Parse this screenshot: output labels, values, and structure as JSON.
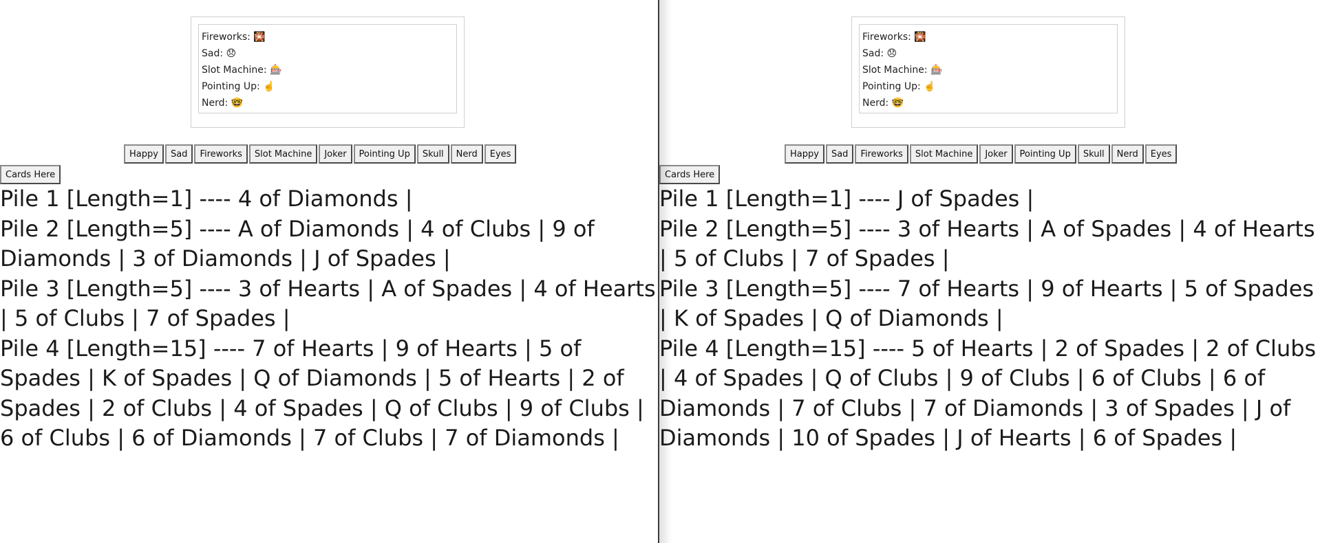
{
  "emoji_list_label": "emoji-list",
  "emoji_buttons": [
    "Happy",
    "Sad",
    "Fireworks",
    "Slot Machine",
    "Joker",
    "Pointing Up",
    "Skull",
    "Nerd",
    "Eyes"
  ],
  "cards_button_label": "Cards Here",
  "left": {
    "emoji_list": [
      {
        "name": "Fireworks:",
        "glyph": "🎇",
        "icon": "fireworks-icon"
      },
      {
        "name": "Sad:",
        "glyph": "😞",
        "icon": "sad-face-icon"
      },
      {
        "name": "Slot Machine:",
        "glyph": "🎰",
        "icon": "slot-machine-icon"
      },
      {
        "name": "Pointing Up:",
        "glyph": "☝️",
        "icon": "pointing-up-icon"
      },
      {
        "name": "Nerd:",
        "glyph": "🤓",
        "icon": "nerd-face-icon"
      }
    ],
    "piles": [
      "Pile 1 [Length=1] ---- 4 of Diamonds |",
      "Pile 2 [Length=5] ---- A of Diamonds | 4 of Clubs | 9 of Diamonds | 3 of Diamonds | J of Spades |",
      "Pile 3 [Length=5] ---- 3 of Hearts | A of Spades | 4 of Hearts | 5 of Clubs | 7 of Spades |",
      "Pile 4 [Length=15] ---- 7 of Hearts | 9 of Hearts | 5 of Spades | K of Spades | Q of Diamonds | 5 of Hearts | 2 of Spades | 2 of Clubs | 4 of Spades | Q of Clubs | 9 of Clubs | 6 of Clubs | 6 of Diamonds | 7 of Clubs | 7 of Diamonds |"
    ]
  },
  "right": {
    "emoji_list": [
      {
        "name": "Fireworks:",
        "glyph": "🎇",
        "icon": "fireworks-icon"
      },
      {
        "name": "Sad:",
        "glyph": "😞",
        "icon": "sad-face-icon"
      },
      {
        "name": "Slot Machine:",
        "glyph": "🎰",
        "icon": "slot-machine-icon"
      },
      {
        "name": "Pointing Up:",
        "glyph": "☝️",
        "icon": "pointing-up-icon"
      },
      {
        "name": "Nerd:",
        "glyph": "🤓",
        "icon": "nerd-face-icon"
      }
    ],
    "piles": [
      "Pile 1 [Length=1] ---- J of Spades |",
      "Pile 2 [Length=5] ---- 3 of Hearts | A of Spades | 4 of Hearts | 5 of Clubs | 7 of Spades |",
      "Pile 3 [Length=5] ---- 7 of Hearts | 9 of Hearts | 5 of Spades | K of Spades | Q of Diamonds |",
      "Pile 4 [Length=15] ---- 5 of Hearts | 2 of Spades | 2 of Clubs | 4 of Spades | Q of Clubs | 9 of Clubs | 6 of Clubs | 6 of Diamonds | 7 of Clubs | 7 of Diamonds | 3 of Spades | J of Diamonds | 10 of Spades | J of Hearts | 6 of Spades |"
    ]
  }
}
